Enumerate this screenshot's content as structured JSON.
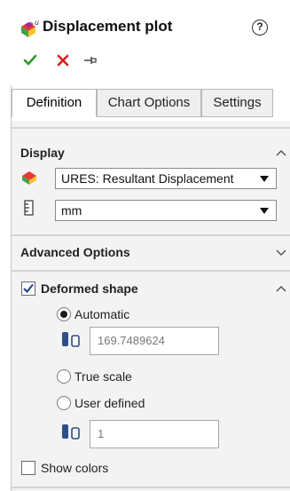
{
  "header": {
    "title": "Displacement plot",
    "help_symbol": "?",
    "title_icon": "displacement-plot-icon",
    "ok_icon": "check-icon",
    "cancel_icon": "close-icon",
    "pin_icon": "pushpin-icon"
  },
  "tabs": [
    {
      "label": "Definition",
      "active": true
    },
    {
      "label": "Chart Options",
      "active": false
    },
    {
      "label": "Settings",
      "active": false
    }
  ],
  "display": {
    "title": "Display",
    "component_value": "URES:  Resultant Displacement",
    "units_value": "mm",
    "expanded": true
  },
  "advanced_options": {
    "title": "Advanced Options",
    "expanded": false
  },
  "deformed_shape": {
    "label": "Deformed shape",
    "checked": true,
    "options": [
      {
        "label": "Automatic",
        "selected": true
      },
      {
        "label": "True scale",
        "selected": false
      },
      {
        "label": "User defined",
        "selected": false
      }
    ],
    "automatic_scale_value": "169.7489624",
    "user_defined_value": "1"
  },
  "show_colors": {
    "label": "Show colors",
    "checked": false
  },
  "colors": {
    "ok_green": "#2e9b2e",
    "cancel_red": "#d42020",
    "panel_bg": "#f3f3f3",
    "scale_icon_blue": "#2d4f8a"
  }
}
